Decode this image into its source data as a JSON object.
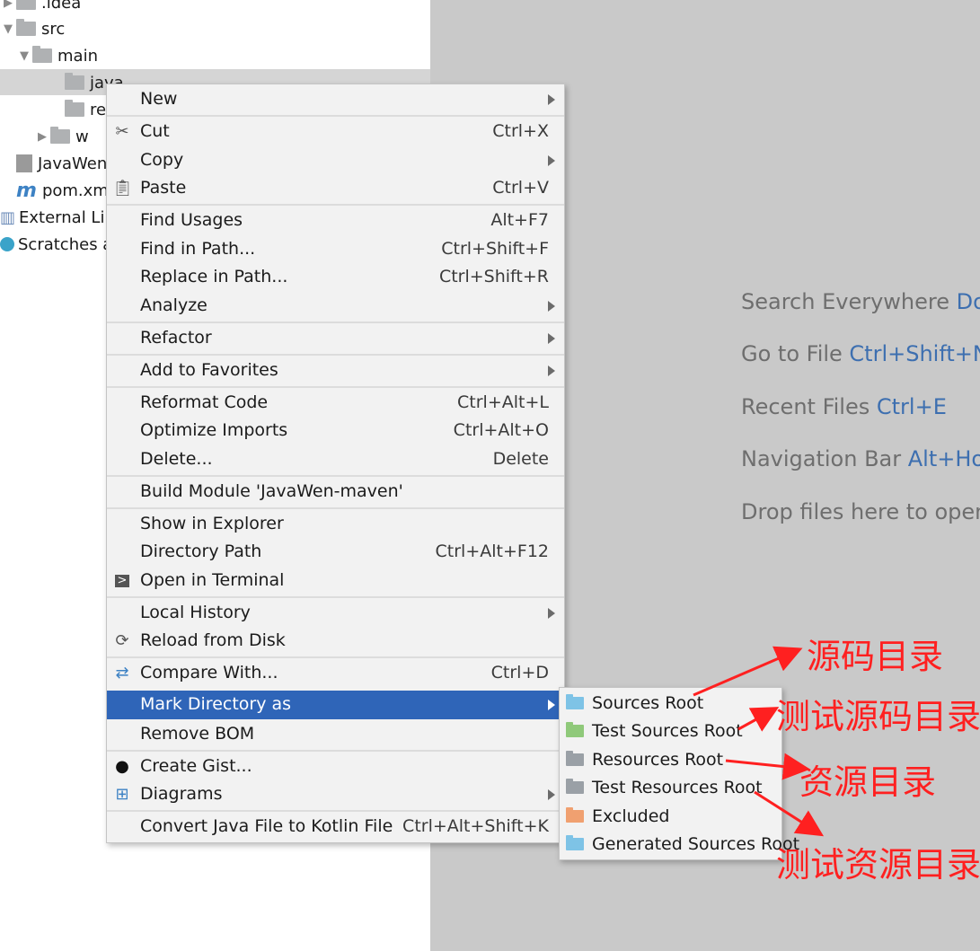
{
  "tree": {
    "items": [
      {
        "label": ".idea"
      },
      {
        "label": "src"
      },
      {
        "label": "main"
      },
      {
        "label": "java"
      },
      {
        "label": "re"
      },
      {
        "label": "w"
      },
      {
        "label": "JavaWen"
      },
      {
        "label": "pom.xm"
      },
      {
        "label": "External Lib"
      },
      {
        "label": "Scratches a"
      }
    ]
  },
  "editor": {
    "hints": [
      {
        "text": "Search Everywhere ",
        "key": "Dou"
      },
      {
        "text": "Go to File ",
        "key": "Ctrl+Shift+N"
      },
      {
        "text": "Recent Files ",
        "key": "Ctrl+E"
      },
      {
        "text": "Navigation Bar ",
        "key": "Alt+Hon"
      },
      {
        "text": "Drop files here to open",
        "key": ""
      }
    ]
  },
  "menu": {
    "items": [
      {
        "label": "New",
        "shortcut": "",
        "submenu": true,
        "icon": ""
      },
      {
        "label": "Cut",
        "shortcut": "Ctrl+X",
        "submenu": false,
        "icon": "scissors-icon"
      },
      {
        "label": "Copy",
        "shortcut": "",
        "submenu": true,
        "icon": ""
      },
      {
        "label": "Paste",
        "shortcut": "Ctrl+V",
        "submenu": false,
        "icon": "clipboard-icon"
      },
      {
        "label": "Find Usages",
        "shortcut": "Alt+F7",
        "submenu": false,
        "icon": ""
      },
      {
        "label": "Find in Path...",
        "shortcut": "Ctrl+Shift+F",
        "submenu": false,
        "icon": ""
      },
      {
        "label": "Replace in Path...",
        "shortcut": "Ctrl+Shift+R",
        "submenu": false,
        "icon": ""
      },
      {
        "label": "Analyze",
        "shortcut": "",
        "submenu": true,
        "icon": ""
      },
      {
        "label": "Refactor",
        "shortcut": "",
        "submenu": true,
        "icon": ""
      },
      {
        "label": "Add to Favorites",
        "shortcut": "",
        "submenu": true,
        "icon": ""
      },
      {
        "label": "Reformat Code",
        "shortcut": "Ctrl+Alt+L",
        "submenu": false,
        "icon": ""
      },
      {
        "label": "Optimize Imports",
        "shortcut": "Ctrl+Alt+O",
        "submenu": false,
        "icon": ""
      },
      {
        "label": "Delete...",
        "shortcut": "Delete",
        "submenu": false,
        "icon": ""
      },
      {
        "label": "Build Module 'JavaWen-maven'",
        "shortcut": "",
        "submenu": false,
        "icon": ""
      },
      {
        "label": "Show in Explorer",
        "shortcut": "",
        "submenu": false,
        "icon": ""
      },
      {
        "label": "Directory Path",
        "shortcut": "Ctrl+Alt+F12",
        "submenu": false,
        "icon": ""
      },
      {
        "label": "Open in Terminal",
        "shortcut": "",
        "submenu": false,
        "icon": "terminal-icon"
      },
      {
        "label": "Local History",
        "shortcut": "",
        "submenu": true,
        "icon": ""
      },
      {
        "label": "Reload from Disk",
        "shortcut": "",
        "submenu": false,
        "icon": "reload-icon"
      },
      {
        "label": "Compare With...",
        "shortcut": "Ctrl+D",
        "submenu": false,
        "icon": "compare-icon"
      },
      {
        "label": "Mark Directory as",
        "shortcut": "",
        "submenu": true,
        "icon": "",
        "selected": true
      },
      {
        "label": "Remove BOM",
        "shortcut": "",
        "submenu": false,
        "icon": ""
      },
      {
        "label": "Create Gist...",
        "shortcut": "",
        "submenu": false,
        "icon": "github-icon"
      },
      {
        "label": "Diagrams",
        "shortcut": "",
        "submenu": true,
        "icon": "diagram-icon"
      },
      {
        "label": "Convert Java File to Kotlin File",
        "shortcut": "Ctrl+Alt+Shift+K",
        "submenu": false,
        "icon": ""
      }
    ]
  },
  "submenu": {
    "items": [
      {
        "label": "Sources Root",
        "color": "#7ec3e6"
      },
      {
        "label": "Test Sources Root",
        "color": "#8fc97a"
      },
      {
        "label": "Resources Root",
        "color": "#9aa0a6"
      },
      {
        "label": "Test Resources Root",
        "color": "#9aa0a6"
      },
      {
        "label": "Excluded",
        "color": "#f0a070"
      },
      {
        "label": "Generated Sources Root",
        "color": "#7ec3e6"
      }
    ]
  },
  "annotations": [
    {
      "text": "源码目录"
    },
    {
      "text": "测试源码目录"
    },
    {
      "text": "资源目录"
    },
    {
      "text": "测试资源目录"
    }
  ],
  "colors": {
    "selection": "#2f65b8",
    "annotation": "#ff2020",
    "hint_key": "#3d6fb0"
  }
}
